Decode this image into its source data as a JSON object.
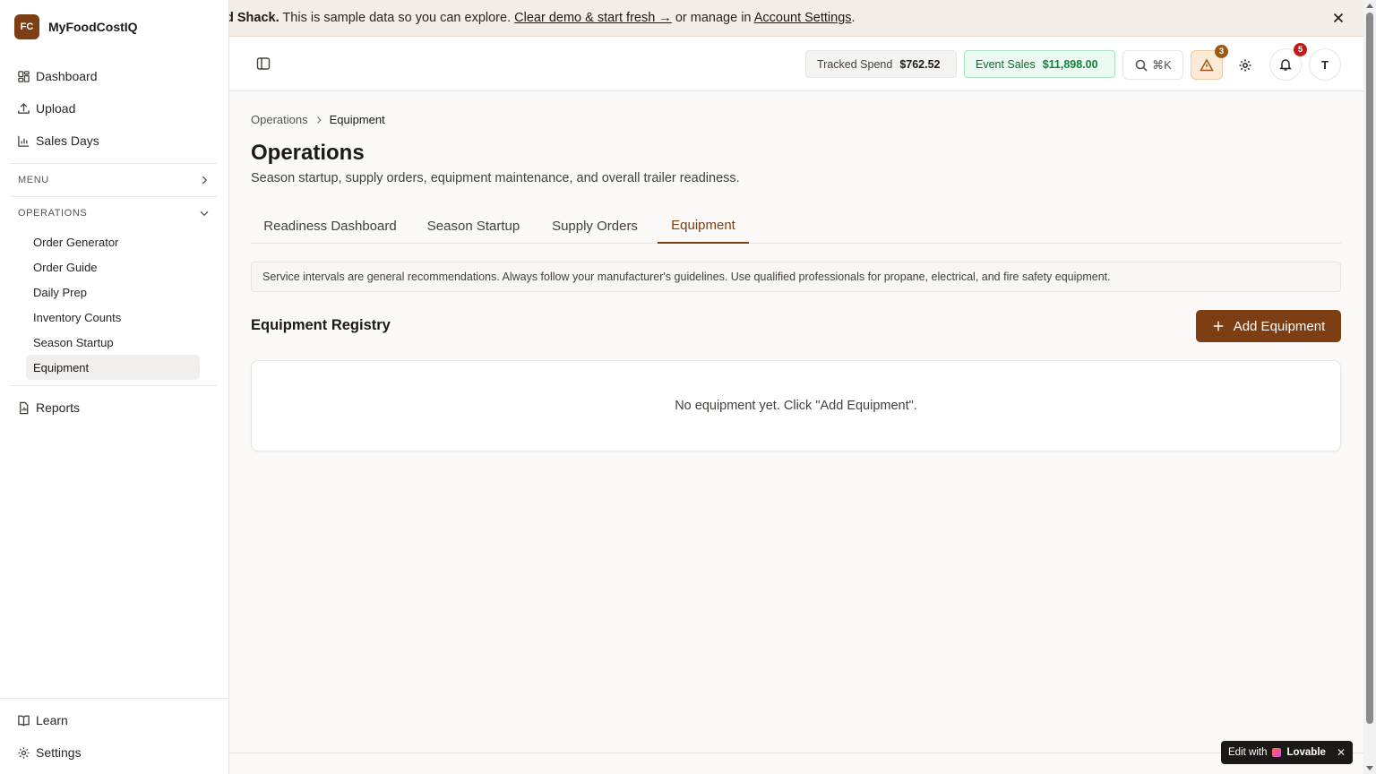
{
  "brand": {
    "logo": "FC",
    "name": "MyFoodCostIQ"
  },
  "sidebar": {
    "top_items": [
      {
        "label": "Dashboard",
        "icon": "dashboard-icon"
      },
      {
        "label": "Upload",
        "icon": "upload-icon"
      },
      {
        "label": "Sales Days",
        "icon": "bar-chart-icon"
      }
    ],
    "menu_section": "MENU",
    "operations_section": "OPERATIONS",
    "operations_items": [
      "Order Generator",
      "Order Guide",
      "Daily Prep",
      "Inventory Counts",
      "Season Startup",
      "Equipment"
    ],
    "active_item": "Equipment",
    "reports": "Reports",
    "bottom_items": [
      {
        "label": "Learn",
        "icon": "book-icon"
      },
      {
        "label": "Settings",
        "icon": "gear-icon"
      }
    ]
  },
  "banner": {
    "bold": "d Shack.",
    "text1": "This is sample data so you can explore.",
    "link1": "Clear demo & start fresh →",
    "text2": "or manage in",
    "link2": "Account Settings",
    "text3": "."
  },
  "header": {
    "tracked_spend_label": "Tracked Spend",
    "tracked_spend_value": "$762.52",
    "event_sales_label": "Event Sales",
    "event_sales_value": "$11,898.00",
    "search_shortcut": "⌘K",
    "warning_count": "3",
    "notification_count": "5",
    "avatar_initial": "T"
  },
  "breadcrumb": {
    "parent": "Operations",
    "current": "Equipment"
  },
  "page": {
    "title": "Operations",
    "subtitle": "Season startup, supply orders, equipment maintenance, and overall trailer readiness."
  },
  "tabs": [
    "Readiness Dashboard",
    "Season Startup",
    "Supply Orders",
    "Equipment"
  ],
  "active_tab": "Equipment",
  "notice": "Service intervals are general recommendations. Always follow your manufacturer's guidelines. Use qualified professionals for propane, electrical, and fire safety equipment.",
  "registry": {
    "title": "Equipment Registry",
    "add_button": "Add Equipment",
    "empty_text": "No equipment yet. Click \"Add Equipment\"."
  },
  "lovable": {
    "prefix": "Edit with",
    "brand": "Lovable",
    "close": "✕"
  },
  "colors": {
    "accent": "#7c3e12",
    "sales_green": "#15803d",
    "alert_red": "#b91c1c"
  }
}
